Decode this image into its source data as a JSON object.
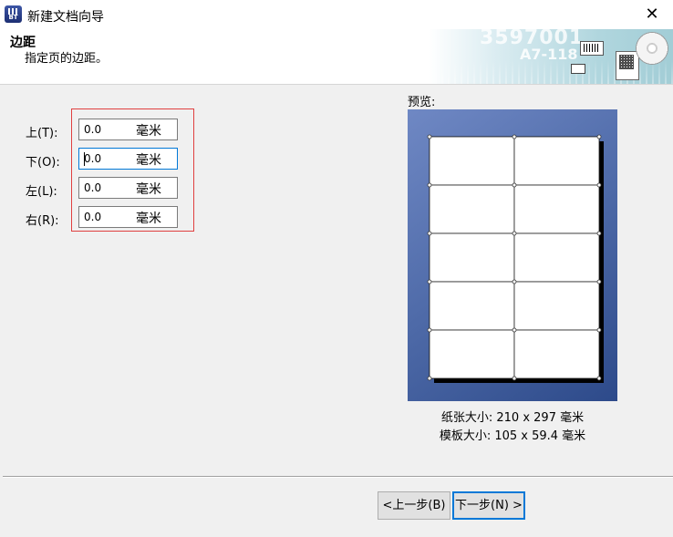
{
  "window": {
    "title": "新建文档向导",
    "app_icon_text": "BT"
  },
  "header": {
    "title": "边距",
    "subtitle": "指定页的边距。",
    "art": {
      "big_number": "3597001",
      "code": "A7-118"
    }
  },
  "margins": {
    "unit": "毫米",
    "fields": [
      {
        "label": "上(T):",
        "value": "0.0"
      },
      {
        "label": "下(O):",
        "value": "0.0"
      },
      {
        "label": "左(L):",
        "value": "0.0"
      },
      {
        "label": "右(R):",
        "value": "0.0"
      }
    ]
  },
  "preview": {
    "label": "预览:",
    "columns": 2,
    "rows": 5,
    "paper_size": "纸张大小: 210 x 297 毫米",
    "template_size": "模板大小: 105 x 59.4 毫米"
  },
  "buttons": {
    "back": "<上一步(B)",
    "next": "下一步(N) >"
  },
  "colors": {
    "accent": "#0078d7",
    "highlight_border": "#e04040",
    "preview_bg": "#4e6aa8"
  }
}
